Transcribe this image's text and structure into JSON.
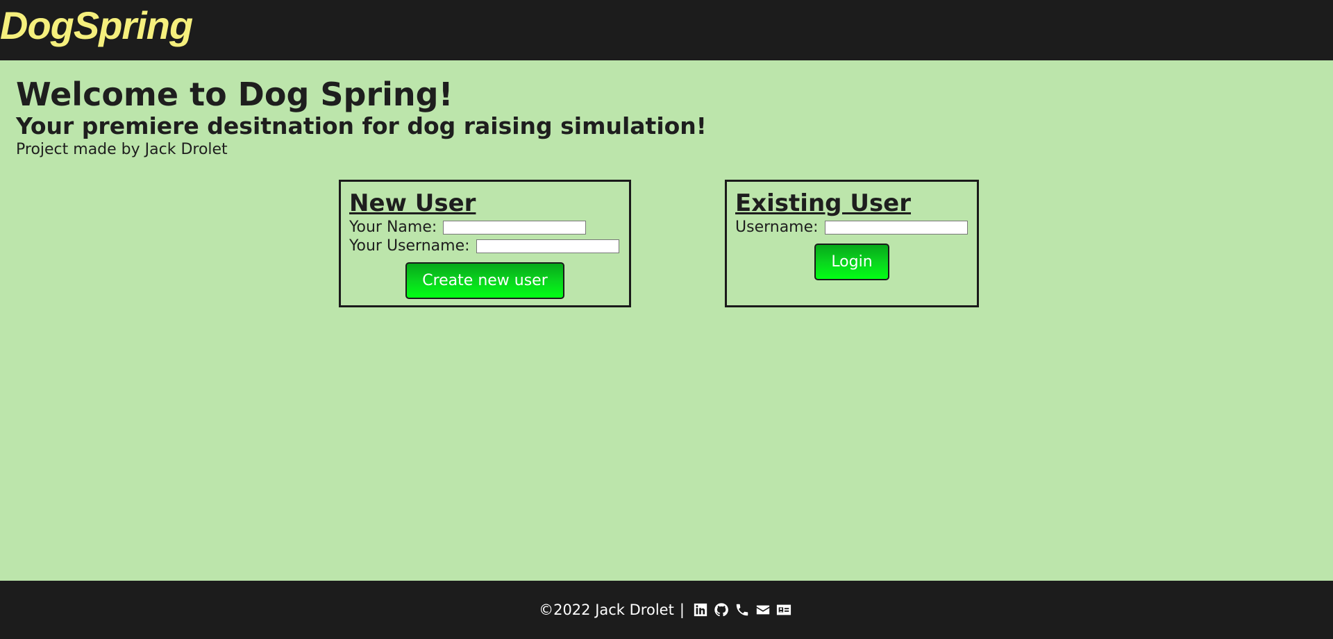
{
  "header": {
    "logo_text": "DogSpring"
  },
  "hero": {
    "title": "Welcome to Dog Spring!",
    "subtitle": "Your premiere desitnation for dog raising simulation!",
    "credit": "Project made by Jack Drolet"
  },
  "new_user": {
    "heading": "New User",
    "name_label": "Your Name:",
    "name_value": "",
    "username_label": "Your Username:",
    "username_value": "",
    "button_label": "Create new user"
  },
  "existing_user": {
    "heading": "Existing User",
    "username_label": "Username:",
    "username_value": "",
    "button_label": "Login"
  },
  "footer": {
    "copyright": "©2022 Jack Drolet",
    "separator": "|",
    "icons": [
      "linkedin-icon",
      "github-icon",
      "phone-icon",
      "email-icon",
      "contact-card-icon"
    ]
  },
  "colors": {
    "header_bg": "#1c1c1c",
    "page_bg": "#bce5ab",
    "logo": "#f5ef7d",
    "button_green": "#0ad41e"
  }
}
